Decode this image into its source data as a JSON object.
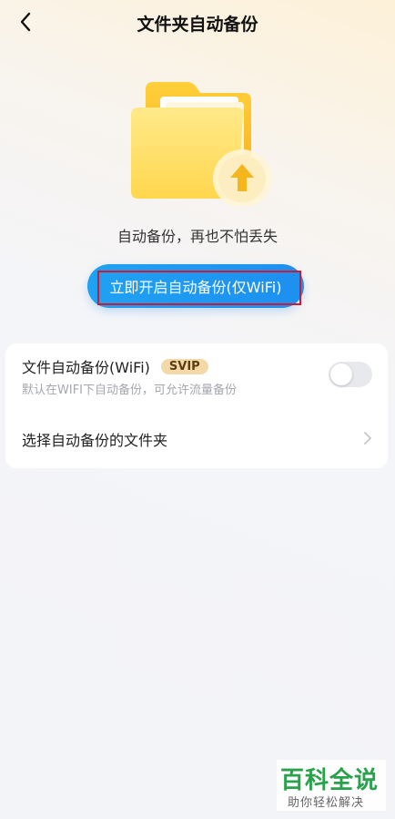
{
  "header": {
    "title": "文件夹自动备份"
  },
  "hero": {
    "tagline": "自动备份，再也不怕丢失"
  },
  "cta": {
    "label": "立即开启自动备份(仅WiFi)"
  },
  "settings": {
    "wifi_backup": {
      "title": "文件自动备份(WiFi)",
      "badge": "SVIP",
      "subtitle": "默认在WIFI下自动备份，可允许流量备份",
      "enabled": false
    },
    "select_folder": {
      "label": "选择自动备份的文件夹"
    }
  },
  "watermark": {
    "main": "百科全说",
    "sub": "助你轻松解决"
  },
  "colors": {
    "accent": "#1e8ff0",
    "highlight_border": "#d0182e",
    "badge_bg": "#f4d9a8",
    "folder": "#ffd54a"
  },
  "icons": {
    "back": "chevron-left-icon",
    "hero": "folder-upload-icon",
    "row_arrow": "chevron-right-icon"
  }
}
